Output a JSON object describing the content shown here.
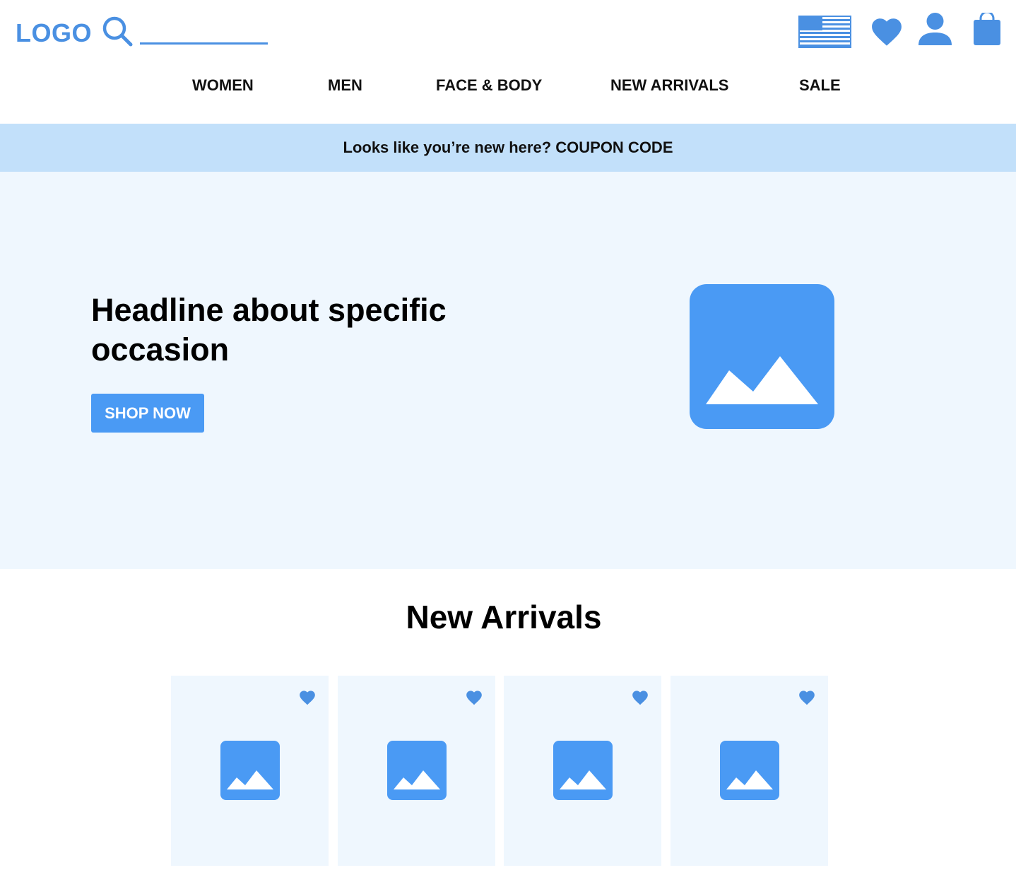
{
  "header": {
    "logo": "LOGO",
    "search": {
      "value": "",
      "placeholder": ""
    },
    "icons": [
      "us-flag-icon",
      "heart-icon",
      "user-icon",
      "shopping-bag-icon"
    ]
  },
  "nav": {
    "items": [
      {
        "label": "WOMEN"
      },
      {
        "label": "MEN"
      },
      {
        "label": "FACE & BODY"
      },
      {
        "label": "NEW ARRIVALS"
      },
      {
        "label": "SALE"
      }
    ]
  },
  "promo": {
    "text": "Looks like you’re new here? COUPON CODE"
  },
  "hero": {
    "headline": "Headline about specific occasion",
    "cta_label": "SHOP NOW",
    "image_icon": "image-placeholder-icon"
  },
  "new_arrivals": {
    "title": "New Arrivals",
    "products": [
      {
        "icon": "image-placeholder-icon",
        "favorite_icon": "heart-icon"
      },
      {
        "icon": "image-placeholder-icon",
        "favorite_icon": "heart-icon"
      },
      {
        "icon": "image-placeholder-icon",
        "favorite_icon": "heart-icon"
      },
      {
        "icon": "image-placeholder-icon",
        "favorite_icon": "heart-icon"
      }
    ]
  },
  "colors": {
    "brand_blue": "#4a90e2",
    "button_blue": "#4a9af4",
    "promo_bg": "#c2e0fa",
    "hero_bg": "#eff7fe",
    "card_bg": "#eff7fe"
  }
}
